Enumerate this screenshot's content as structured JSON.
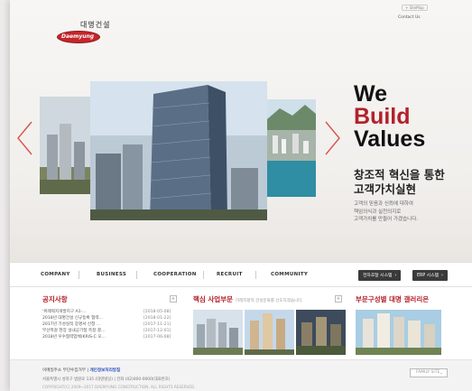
{
  "brand": {
    "name_ko": "대명건설",
    "name_en": "Daemyung"
  },
  "utility": {
    "sitemap": "+ SiteMap",
    "contact": "Contact Us"
  },
  "hero": {
    "tag_we": "We",
    "tag_build": "Build",
    "tag_values": "Values",
    "heading_line1": "창조적 혁신을 통한",
    "heading_line2": "고객가치실현",
    "sub_line1": "고객의 믿음과 신뢰에 대하여",
    "sub_line2": "책임의식과 실천의지로",
    "sub_line3": "고객가치를 만들어 가겠습니다."
  },
  "nav": {
    "items": [
      "COMPANY",
      "BUSINESS",
      "COOPERATION",
      "RECRUIT",
      "COMMUNITY"
    ],
    "btn_bid": "전자조달 시스템",
    "btn_erp": "ERP 시스템"
  },
  "notice": {
    "title": "공지사항",
    "more": "+",
    "rows": [
      {
        "title": "'위례택지개발지구 A1-...",
        "date": "[2018-05-08]"
      },
      {
        "title": "2018년 대명건설 신규등록 협력...",
        "date": "[2018-01-22]"
      },
      {
        "title": "2017년 기성실적 증명서 신청 ...",
        "date": "[2017-11-21]"
      },
      {
        "title": "부산목걸 현장 설내공기질 측정 결...",
        "date": "[2017-12-01]"
      },
      {
        "title": "2018년 우수협력업체(KRIS-C 오...",
        "date": "[2017-06-08]"
      }
    ]
  },
  "business": {
    "title": "핵심 사업부문",
    "subtitle": "미래지향적 건설문화를 선도하겠습니다.",
    "more": "+"
  },
  "pr": {
    "title": "부문구성별 대명 갤러리온",
    "more": "+"
  },
  "footer": {
    "link1": "이메일주소 무단수집거부",
    "sep": "|",
    "link2": "개인정보처리방침",
    "address": "서울특별시 성북구 법원로 135 (대명빌딩) | 전화 (02)000-0000(대표번호)",
    "copyright": "COPYRIGHT(C) 2009~2017 DAEMYUNG CONSTRUCTION. ALL RIGHTS RESERVED.",
    "family_site": "FAMILY SITE"
  },
  "colors": {
    "accent_red": "#b2212a",
    "nav_button": "#3a3a3a",
    "link_blue": "#2a4fbf"
  }
}
